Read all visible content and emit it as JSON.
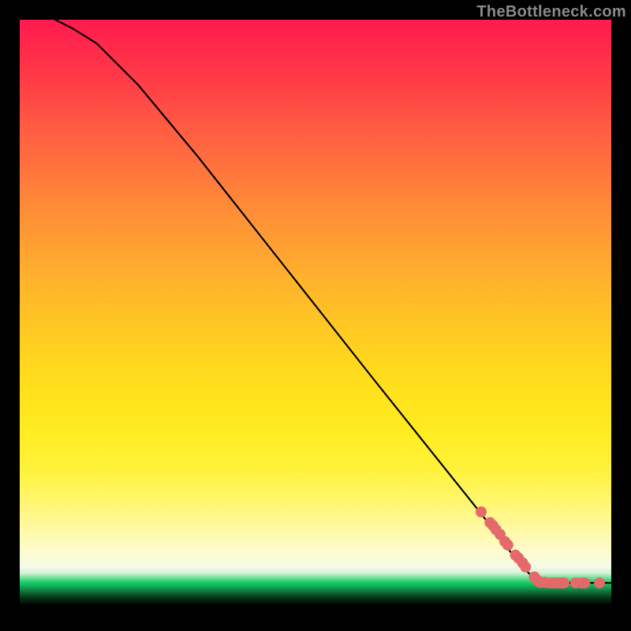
{
  "watermark": "TheBottleneck.com",
  "chart_data": {
    "type": "line",
    "title": "",
    "xlabel": "",
    "ylabel": "",
    "xlim": [
      0,
      1
    ],
    "ylim": [
      0,
      1
    ],
    "grid": false,
    "curve": {
      "name": "main-curve",
      "color": "#000000",
      "x": [
        0.06,
        0.09,
        0.13,
        0.2,
        0.3,
        0.45,
        0.6,
        0.7,
        0.78,
        0.83,
        0.86,
        0.875,
        0.9,
        0.95,
        1.0
      ],
      "y": [
        1.0,
        0.985,
        0.96,
        0.89,
        0.77,
        0.58,
        0.39,
        0.265,
        0.165,
        0.1,
        0.065,
        0.05,
        0.048,
        0.048,
        0.048
      ]
    },
    "markers": {
      "name": "highlighted-points",
      "color": "#e46a6a",
      "radius_px": 7,
      "x": [
        0.78,
        0.795,
        0.8,
        0.805,
        0.812,
        0.82,
        0.825,
        0.838,
        0.843,
        0.85,
        0.855,
        0.87,
        0.875,
        0.878,
        0.88,
        0.888,
        0.895,
        0.9,
        0.905,
        0.912,
        0.917,
        0.92,
        0.94,
        0.95,
        0.955,
        0.98
      ],
      "y": [
        0.168,
        0.15,
        0.145,
        0.138,
        0.13,
        0.118,
        0.112,
        0.095,
        0.09,
        0.082,
        0.075,
        0.058,
        0.052,
        0.05,
        0.049,
        0.049,
        0.048,
        0.048,
        0.048,
        0.048,
        0.048,
        0.048,
        0.048,
        0.048,
        0.048,
        0.048
      ]
    }
  }
}
